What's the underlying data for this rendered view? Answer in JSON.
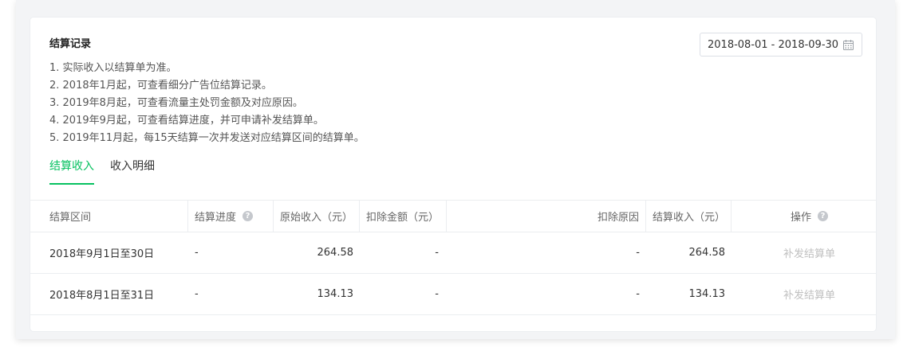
{
  "card": {
    "title": "结算记录",
    "notes": [
      "1. 实际收入以结算单为准。",
      "2. 2018年1月起，可查看细分广告位结算记录。",
      "3. 2019年8月起，可查看流量主处罚金额及对应原因。",
      "4. 2019年9月起，可查看结算进度，并可申请补发结算单。",
      "5. 2019年11月起，每15天结算一次并发送对应结算区间的结算单。"
    ]
  },
  "date_range": {
    "value": "2018-08-01 - 2018-09-30",
    "icon": "calendar-icon"
  },
  "tabs": [
    {
      "label": "结算收入",
      "active": true
    },
    {
      "label": "收入明细",
      "active": false
    }
  ],
  "accent_color": "#07c160",
  "table": {
    "headers": [
      "结算区间",
      "结算进度",
      "原始收入（元）",
      "扣除金额（元）",
      "扣除原因",
      "结算收入（元）",
      "操作"
    ],
    "help_icon_glyph": "?",
    "rows": [
      {
        "period": "2018年9月1日至30日",
        "progress": "-",
        "original": "264.58",
        "deduction": "-",
        "reason": "-",
        "settled": "264.58",
        "action": "补发结算单"
      },
      {
        "period": "2018年8月1日至31日",
        "progress": "-",
        "original": "134.13",
        "deduction": "-",
        "reason": "-",
        "settled": "134.13",
        "action": "补发结算单"
      }
    ]
  }
}
